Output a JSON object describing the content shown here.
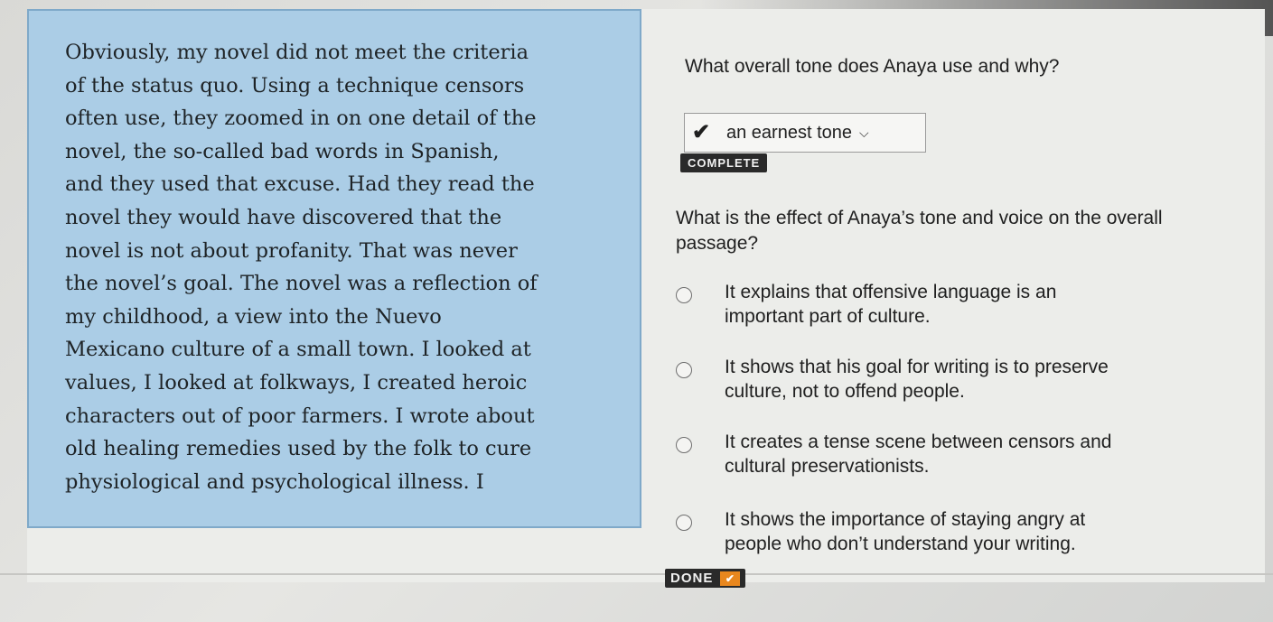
{
  "passage": {
    "text": "Obviously, my novel did not meet the criteria\nof the status quo. Using a technique censors\noften use, they zoomed in on one detail of the\nnovel, the so-called bad words in Spanish,\nand they used that excuse. Had they read the\nnovel they would have discovered that the\nnovel is not about profanity. That was never\nthe novel’s goal. The novel was a reflection of\nmy childhood, a view into the Nuevo\nMexicano culture of a small town. I looked at\nvalues, I looked at folkways, I created heroic\ncharacters out of poor farmers. I wrote about\nold healing remedies used by the folk to cure\nphysiological and psychological illness. I"
  },
  "question1": {
    "prompt": "What overall tone does Anaya use and why?",
    "selected_answer": "an earnest tone",
    "status_badge": "COMPLETE"
  },
  "question2": {
    "prompt": "What is the effect of Anaya’s tone and voice on the overall passage?",
    "options": [
      "It explains that offensive language is an\nimportant part of culture.",
      "It shows that his goal for writing is to preserve\nculture, not to offend people.",
      "It creates a tense scene between censors and\ncultural preservationists.",
      "It shows the importance of staying angry at\npeople who don’t understand your writing."
    ]
  },
  "footer": {
    "done_label": "DONE"
  },
  "colors": {
    "passage_bg": "#abcde6",
    "done_check": "#e8871e"
  },
  "icons": {
    "check": "checkmark-icon",
    "chevron": "chevron-down-icon",
    "radio": "radio-button-icon"
  }
}
